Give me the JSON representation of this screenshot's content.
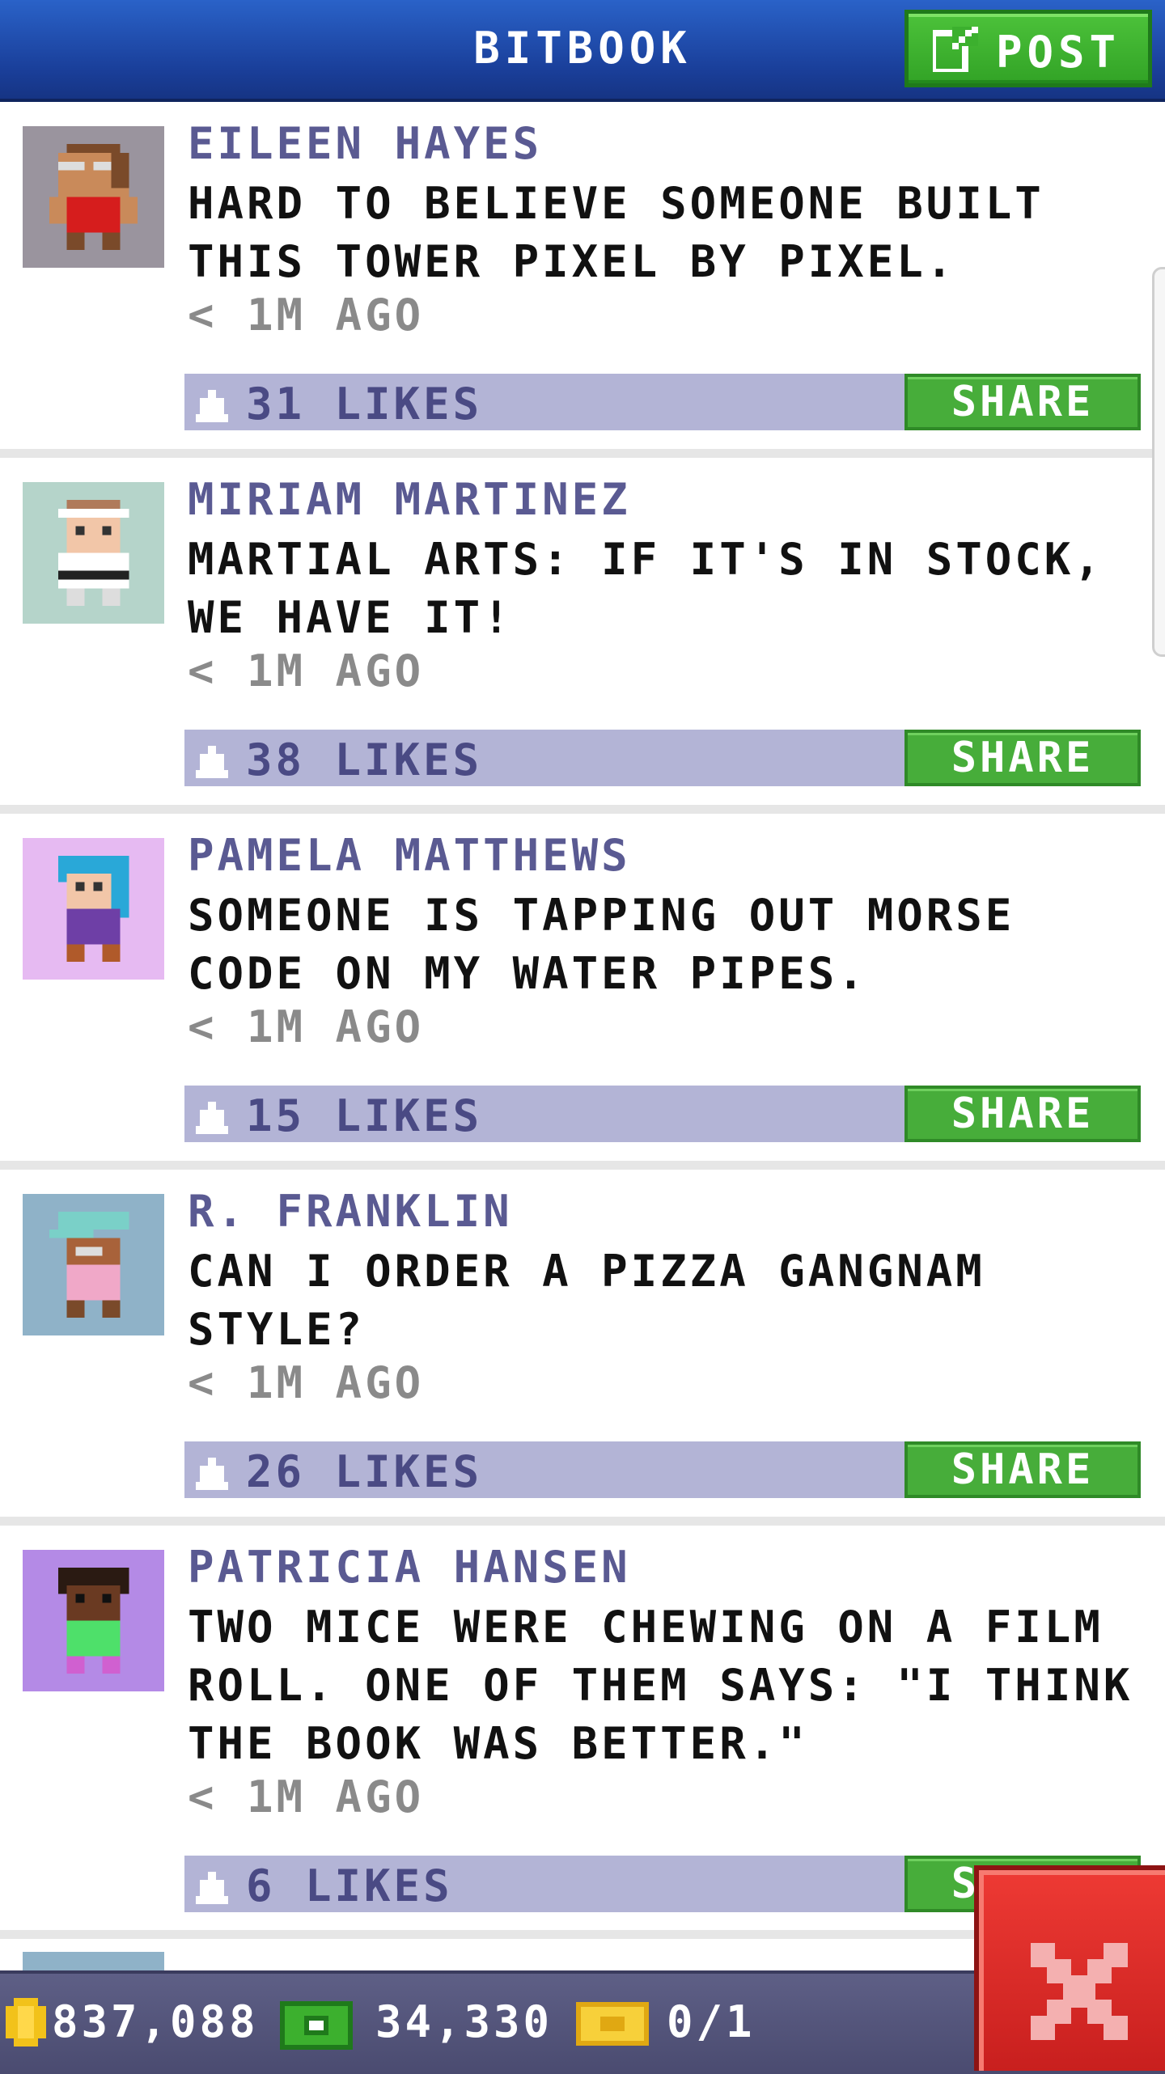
{
  "header": {
    "title": "BITBOOK",
    "post_label": "POST"
  },
  "posts": [
    {
      "name": "EILEEN HAYES",
      "text": "HARD TO BELIEVE SOMEONE BUILT THIS TOWER PIXEL BY PIXEL.",
      "time": "< 1M AGO",
      "likes": "31 LIKES",
      "share": "SHARE",
      "avatar_bg": "#9a949e"
    },
    {
      "name": "MIRIAM MARTINEZ",
      "text": "MARTIAL ARTS: IF IT'S IN STOCK, WE HAVE IT!",
      "time": "< 1M AGO",
      "likes": "38 LIKES",
      "share": "SHARE",
      "avatar_bg": "#b5d4ca"
    },
    {
      "name": "PAMELA MATTHEWS",
      "text": "SOMEONE IS TAPPING OUT MORSE CODE ON MY WATER PIPES.",
      "time": "< 1M AGO",
      "likes": "15 LIKES",
      "share": "SHARE",
      "avatar_bg": "#e6baf2"
    },
    {
      "name": "R. FRANKLIN",
      "text": "CAN I ORDER A PIZZA GANGNAM STYLE?",
      "time": "< 1M AGO",
      "likes": "26 LIKES",
      "share": "SHARE",
      "avatar_bg": "#8fb2c8"
    },
    {
      "name": "PATRICIA HANSEN",
      "text": "TWO MICE WERE CHEWING ON A FILM ROLL. ONE OF THEM SAYS: \"I THINK THE BOOK WAS BETTER.\"",
      "time": "< 1M AGO",
      "likes": "6 LIKES",
      "share": "SHARE",
      "avatar_bg": "#b48ae6"
    }
  ],
  "bottom": {
    "coins": "837,088",
    "cash": "34,330",
    "bux": "0/1"
  },
  "colors": {
    "header": "#1a3f9a",
    "share_green": "#47ad3a",
    "like_bar": "#b3b4d6",
    "name_purple": "#5a5a92",
    "close_red": "#d92a26"
  },
  "icons": [
    "edit-icon",
    "like-icon",
    "coin-icon",
    "cash-icon",
    "bux-ticket-icon",
    "close-icon"
  ]
}
